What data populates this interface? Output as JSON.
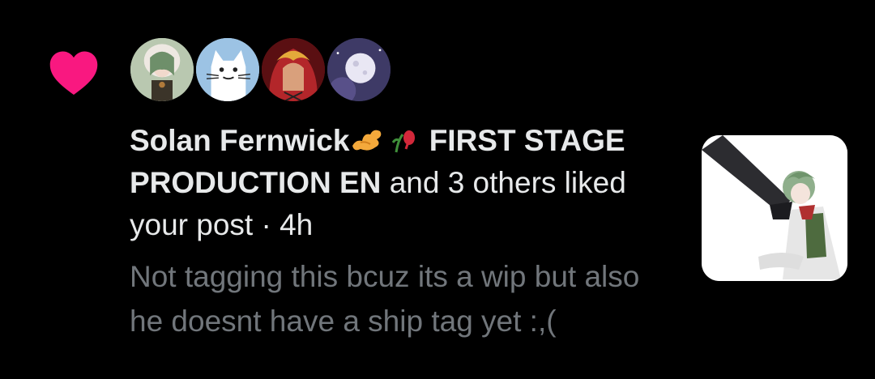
{
  "notification": {
    "type_icon": "heart-icon",
    "heart_color": "#f91880",
    "avatars": [
      {
        "name": "avatar-green-hair-character"
      },
      {
        "name": "avatar-white-cat"
      },
      {
        "name": "avatar-red-hair-character"
      },
      {
        "name": "avatar-moon"
      }
    ],
    "liker_name": "Solan Fernwick",
    "liker_emojis": [
      "ginger-emoji",
      "wilted-rose-emoji"
    ],
    "liker_name_suffix": "FIRST STAGE PRODUCTION EN",
    "and_others": "and 3 others liked your post",
    "separator": "·",
    "timestamp": "4h",
    "post_text": "Not tagging this bcuz its a wip but also he doesnt have a ship tag yet :,(",
    "thumbnail": "post-thumbnail-drawing"
  }
}
